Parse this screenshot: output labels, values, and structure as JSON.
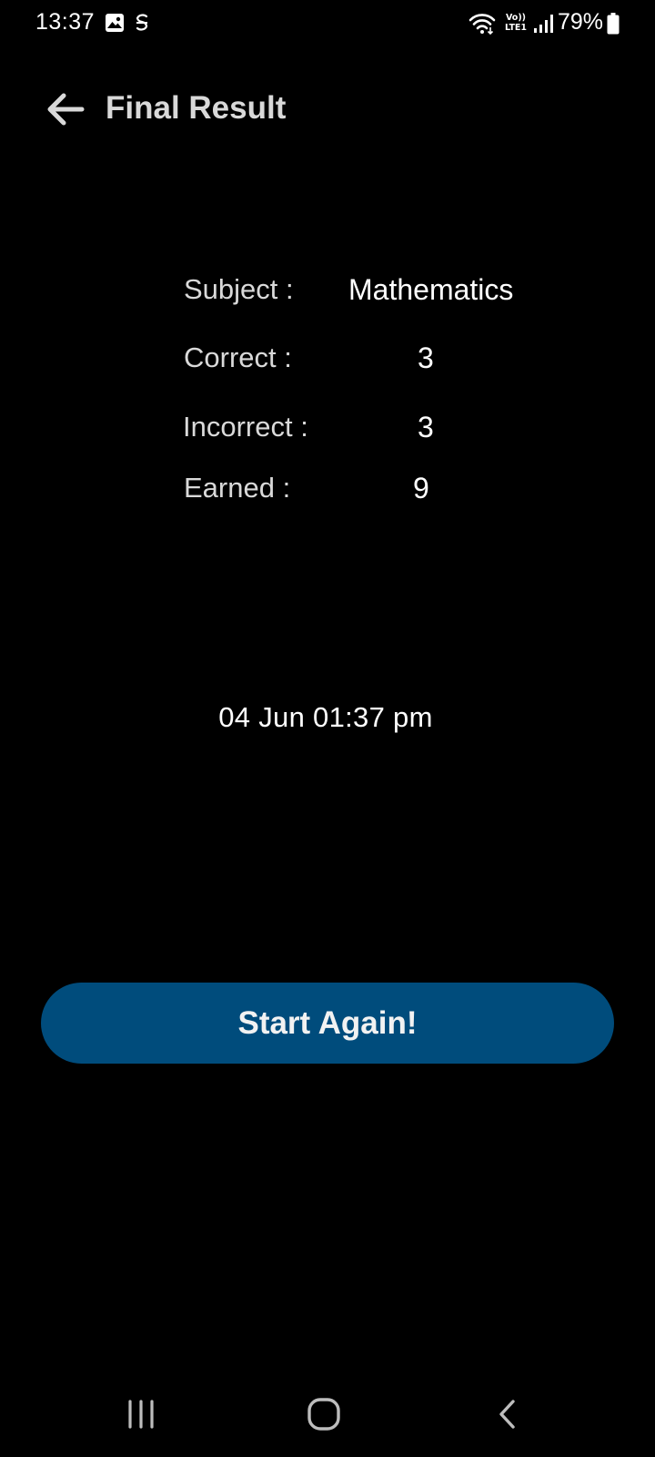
{
  "status_bar": {
    "time": "13:37",
    "battery_percent": "79%",
    "volte_line1": "Vo))",
    "volte_line2": "LTE1",
    "icons": [
      "gallery-icon",
      "sync-icon",
      "wifi-icon",
      "volte-icon",
      "signal-icon",
      "battery-icon"
    ]
  },
  "app_bar": {
    "title": "Final Result",
    "back_icon": "arrow-left-icon"
  },
  "results": {
    "subject_label": "Subject :",
    "subject_value": "Mathematics",
    "correct_label": "Correct :",
    "correct_value": "3",
    "incorrect_label": "Incorrect :",
    "incorrect_value": "3",
    "earned_label": "Earned :",
    "earned_value": "9"
  },
  "timestamp": "04 Jun 01:37 pm",
  "start_button": {
    "label": "Start Again!",
    "color": "#004c7c"
  },
  "nav_bar": {
    "icons": [
      "recents-icon",
      "home-icon",
      "back-icon"
    ]
  },
  "colors": {
    "background": "#000000",
    "label_text": "#d9d9d9",
    "value_text": "#ffffff"
  }
}
